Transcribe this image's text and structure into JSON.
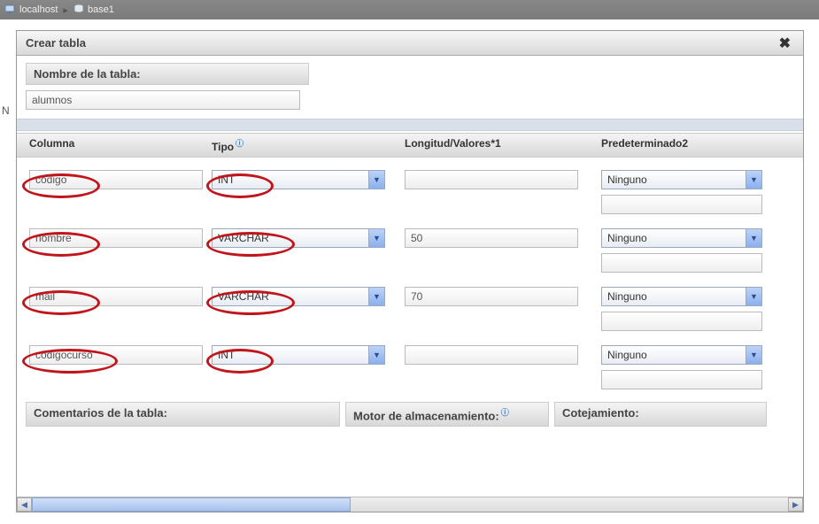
{
  "breadcrumb": {
    "host": "localhost",
    "db": "base1"
  },
  "leftChar": "N",
  "dialog": {
    "title": "Crear tabla",
    "tableNameLabel": "Nombre de la tabla:",
    "tableNameValue": "alumnos",
    "headers": {
      "columna": "Columna",
      "tipo": "Tipo",
      "longitud": "Longitud/Valores*1",
      "predeterminado": "Predeterminado2"
    },
    "defaultLabel": "Ninguno",
    "fields": [
      {
        "name": "codigo",
        "type": "INT",
        "length": "",
        "default": "Ninguno"
      },
      {
        "name": "nombre",
        "type": "VARCHAR",
        "length": "50",
        "default": "Ninguno"
      },
      {
        "name": "mail",
        "type": "VARCHAR",
        "length": "70",
        "default": "Ninguno"
      },
      {
        "name": "codigocurso",
        "type": "INT",
        "length": "",
        "default": "Ninguno"
      }
    ],
    "bottom": {
      "comentarios": "Comentarios de la tabla:",
      "motor": "Motor de almacenamiento:",
      "cotejamiento": "Cotejamiento:"
    }
  }
}
